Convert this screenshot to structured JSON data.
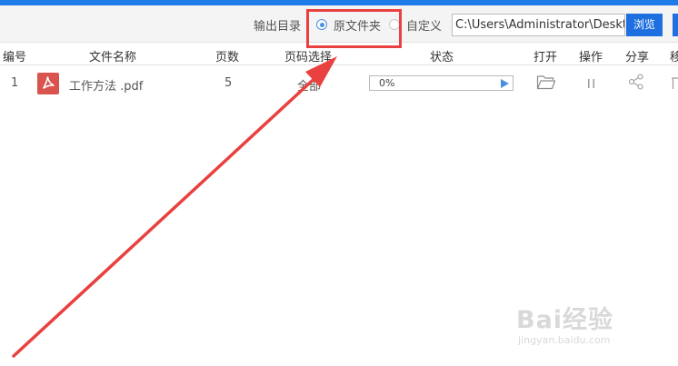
{
  "toolbar": {
    "output_label": "输出目录",
    "option_original": "原文件夹",
    "option_custom": "自定义",
    "path_value": "C:\\Users\\Administrator\\Desktop",
    "browse_label": "浏览"
  },
  "table": {
    "headers": {
      "index": "编号",
      "filename": "文件名称",
      "pages": "页数",
      "page_select": "页码选择",
      "status": "状态",
      "open": "打开",
      "operate": "操作",
      "share": "分享",
      "remove": "移"
    },
    "rows": [
      {
        "index": "1",
        "filename": "工作方法 .pdf",
        "pages": "5",
        "page_select": "全部",
        "progress_text": "0%",
        "progress": 0
      }
    ]
  },
  "icons": {
    "file_type": "pdf-file-icon",
    "open": "folder-open-icon",
    "operate": "pause-icon",
    "share": "share-icon",
    "remove": "trash-icon"
  },
  "colors": {
    "accent": "#1e6fe0",
    "radio_selected": "#4a90e2",
    "pdf_icon": "#d9544f",
    "annotation": "#e8413f"
  },
  "watermark": {
    "brand": "Bai经验",
    "url": "jingyan.baidu.com"
  }
}
